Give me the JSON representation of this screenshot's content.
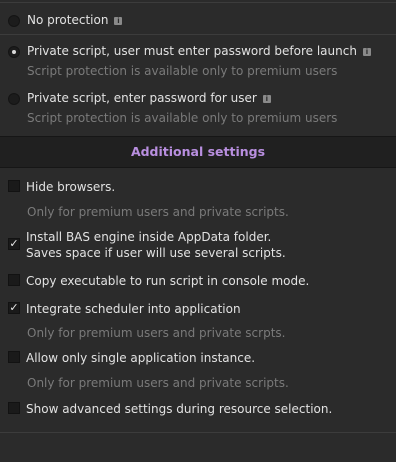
{
  "protection": {
    "options": [
      {
        "label": "No protection",
        "checked": false,
        "note": ""
      },
      {
        "label": "Private script, user must enter password before launch",
        "checked": true,
        "note": "Script protection is available only to premium users"
      },
      {
        "label": "Private script, enter password for user",
        "checked": false,
        "note": "Script protection is available only to premium users"
      }
    ],
    "info_icon": "info-icon"
  },
  "additional": {
    "title": "Additional settings",
    "items": [
      {
        "label": "Hide browsers.",
        "checked": false,
        "note": "Only for premium users and private scripts."
      },
      {
        "label": "Install BAS engine inside AppData folder.",
        "label2": "Saves space if user will use several scripts.",
        "checked": true
      },
      {
        "label": "Copy executable to run script in console mode.",
        "checked": false
      },
      {
        "label": "Integrate scheduler into application",
        "checked": true,
        "note": "Only for premium users and private scrpts."
      },
      {
        "label": "Allow only single application instance.",
        "checked": false,
        "note": "Only for premium users and private scripts."
      },
      {
        "label": "Show advanced settings during resource selection.",
        "checked": false
      }
    ],
    "check_mark": "✓"
  },
  "colors": {
    "accent": "#b98fe0",
    "background": "#2b2b2b",
    "muted_text": "#7a7a7a"
  }
}
